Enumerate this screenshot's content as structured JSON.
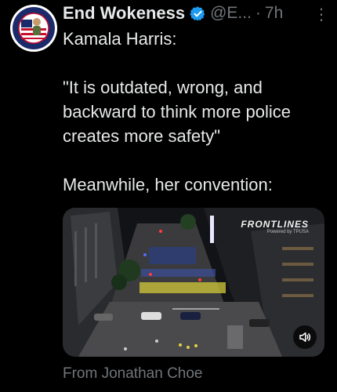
{
  "tweet": {
    "author_name": "End Wokeness",
    "handle": "@E...",
    "separator": "·",
    "time": "7h",
    "more_label": "⋮",
    "text": "Kamala Harris:\n\n\"It is outdated, wrong, and backward to think more police creates more safety\"\n\nMeanwhile, her convention:",
    "media": {
      "watermark_title": "FRONTLINES",
      "watermark_sub": "Powered by TPUSA"
    },
    "attribution": "From Jonathan Choe"
  },
  "avatar": {
    "badge_top": "SUPPORT FOR",
    "badge_bottom": "BORDER PATROL"
  },
  "colors": {
    "background": "#000000",
    "text": "#e7e9ea",
    "muted": "#71767b",
    "verified": "#1d9bf0"
  },
  "icons": {
    "verified": "verified-badge-icon",
    "more": "more-options-icon",
    "sound": "speaker-icon"
  }
}
